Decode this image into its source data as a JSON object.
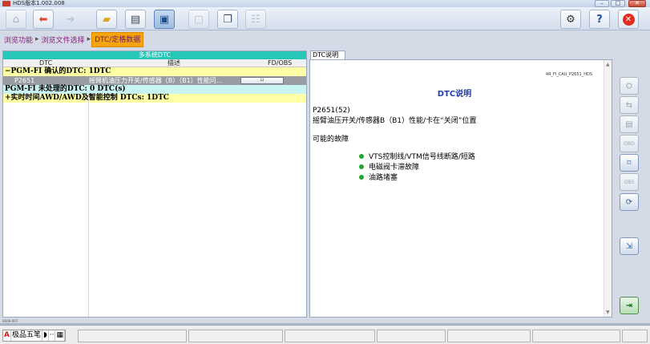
{
  "window": {
    "title": "HDS版本1.002.008",
    "controls": [
      "min",
      "max",
      "close"
    ]
  },
  "toolbar": {
    "buttons": [
      {
        "name": "home-icon",
        "glyph": "⌂"
      },
      {
        "name": "back-arrow-icon",
        "glyph": "⬅"
      },
      {
        "name": "forward-arrow-icon",
        "glyph": "➔"
      },
      {
        "name": "open-folder-icon",
        "glyph": "📂"
      },
      {
        "name": "print-icon",
        "glyph": "🖶"
      },
      {
        "name": "screen-capture-icon",
        "glyph": "▭"
      },
      {
        "name": "window-icon",
        "glyph": "▢"
      },
      {
        "name": "windows-stack-icon",
        "glyph": "❐"
      },
      {
        "name": "data-list-icon",
        "glyph": "☷"
      }
    ],
    "right_buttons": [
      {
        "name": "gear-icon",
        "glyph": "⚙"
      },
      {
        "name": "help-icon",
        "glyph": "?"
      },
      {
        "name": "exit-icon",
        "glyph": "✕"
      }
    ]
  },
  "breadcrumb": {
    "items": [
      "浏览功能",
      "浏览文件选择",
      "DTC/定格数据"
    ],
    "separator": "▸"
  },
  "dtc_panel": {
    "header": "多系统DTC",
    "columns": {
      "dtc": "DTC",
      "desc": "描述",
      "fd": "FD/OBS"
    },
    "groups": [
      {
        "label": "−PGM-FI 确认的DTC: 1DTC"
      },
      {
        "label": "PGM-FI 未处理的DTC: 0 DTC(s)"
      },
      {
        "label": "+实时时间AWD/AWD及智能控制 DTCs: 1DTC"
      }
    ],
    "row": {
      "code": "P2651",
      "desc": "摇臂机油压力开关/传感器（B）（B1）性能问...",
      "button": "⌑"
    }
  },
  "dtc_info": {
    "tab": "DTC说明",
    "doc_id": "4R_FI_CAU_P2651_HDS",
    "title": "DTC说明",
    "code": "P2651(52)",
    "description": "摇臂油压开关/传感器B（B1）性能/卡在“关闭”位置",
    "causes_title": "可能的故障",
    "causes": [
      "VTS控制线/VTM信号线断路/短路",
      "电磁阀卡滞故障",
      "油路堵塞"
    ]
  },
  "sidebar": {
    "buttons": [
      {
        "name": "sidebar-btn-1",
        "glyph": "⛭",
        "enabled": false
      },
      {
        "name": "sidebar-btn-2",
        "glyph": "⇆",
        "enabled": false
      },
      {
        "name": "sidebar-btn-3",
        "glyph": "▤",
        "enabled": false
      },
      {
        "name": "sidebar-btn-obd",
        "glyph": "OBD",
        "enabled": false
      },
      {
        "name": "sidebar-btn-5",
        "glyph": "⌑",
        "enabled": true
      },
      {
        "name": "sidebar-btn-obs",
        "glyph": "OBS",
        "enabled": false
      },
      {
        "name": "sidebar-btn-refresh",
        "glyph": "⟳",
        "enabled": true
      },
      {
        "name": "sidebar-btn-export",
        "glyph": "⇲",
        "enabled": true
      },
      {
        "name": "sidebar-btn-exit",
        "glyph": "⇥",
        "enabled": true
      }
    ]
  },
  "statusbar": {
    "ime": {
      "a": "A",
      "text": "极品五笔",
      "b": "◗",
      "c": "··",
      "d": "▦"
    },
    "mini_label": "0609-007"
  }
}
